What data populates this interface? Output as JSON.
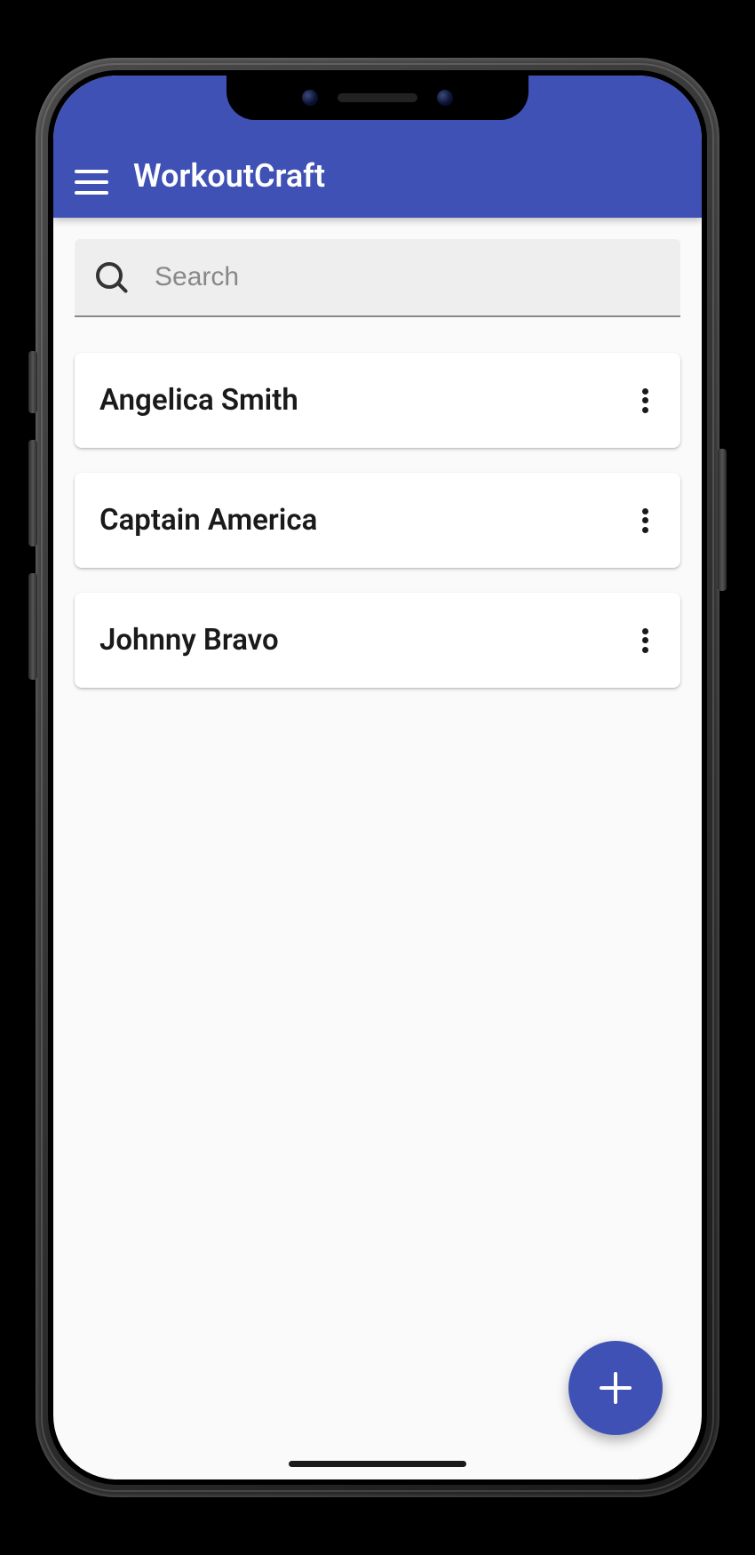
{
  "header": {
    "title": "WorkoutCraft"
  },
  "search": {
    "placeholder": "Search",
    "value": ""
  },
  "list": {
    "items": [
      {
        "name": "Angelica Smith"
      },
      {
        "name": "Captain America"
      },
      {
        "name": "Johnny Bravo"
      }
    ]
  },
  "colors": {
    "primary": "#3f51b5",
    "background": "#fafafa",
    "card": "#ffffff",
    "search_bg": "#eeeeee"
  },
  "icons": {
    "menu": "menu-icon",
    "search": "search-icon",
    "more": "more-vert-icon",
    "fab": "plus-icon"
  }
}
